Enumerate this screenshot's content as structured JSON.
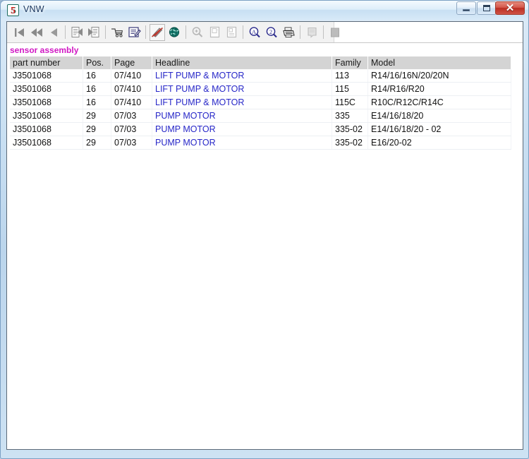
{
  "window": {
    "title": "VNW",
    "app_icon": "app-5-icon",
    "caption_buttons": {
      "minimize": "Minimize",
      "maximize": "Maximize",
      "close": "✕"
    }
  },
  "toolbar": {
    "groups": [
      {
        "buttons": [
          {
            "name": "first-record-button",
            "icon": "skip-to-first-icon",
            "label": "First",
            "enabled": true
          },
          {
            "name": "rewind-button",
            "icon": "rewind-double-arrow-icon",
            "label": "Previous block",
            "enabled": true
          },
          {
            "name": "previous-record-button",
            "icon": "previous-arrow-icon",
            "label": "Previous",
            "enabled": true
          }
        ]
      },
      {
        "buttons": [
          {
            "name": "document-back-button",
            "icon": "document-previous-icon",
            "label": "Back document",
            "enabled": true
          },
          {
            "name": "document-forward-button",
            "icon": "document-next-icon",
            "label": "Forward document",
            "enabled": true
          }
        ]
      },
      {
        "buttons": [
          {
            "name": "shopping-cart-button",
            "icon": "shopping-cart-icon",
            "label": "Basket",
            "enabled": true
          },
          {
            "name": "edit-order-button",
            "icon": "clipboard-pencil-icon",
            "label": "Edit order",
            "enabled": true
          }
        ]
      },
      {
        "buttons": [
          {
            "name": "hide-markup-button",
            "icon": "pen-strikethrough-icon",
            "label": "Annotation off",
            "enabled": true,
            "framed": true
          },
          {
            "name": "globe-button",
            "icon": "globe-icon",
            "label": "Web",
            "enabled": true
          }
        ]
      },
      {
        "buttons": [
          {
            "name": "zoom-button",
            "icon": "magnifier-plus-icon",
            "label": "Zoom",
            "enabled": false
          },
          {
            "name": "page-view-button",
            "icon": "page-icon",
            "label": "Page view",
            "enabled": false
          },
          {
            "name": "page-view-alt-button",
            "icon": "page-alt-icon",
            "label": "Page view 2",
            "enabled": false
          }
        ]
      },
      {
        "buttons": [
          {
            "name": "find-text-button",
            "icon": "letter-a-magnifier-icon",
            "label": "Find text",
            "enabled": true
          },
          {
            "name": "find-number-button",
            "icon": "number-2-magnifier-icon",
            "label": "Find number",
            "enabled": true
          },
          {
            "name": "print-button",
            "icon": "printer-icon",
            "label": "Print",
            "enabled": true
          }
        ]
      },
      {
        "buttons": [
          {
            "name": "notes-button",
            "icon": "notepad-icon",
            "label": "Notes",
            "enabled": false
          }
        ]
      },
      {
        "buttons": [
          {
            "name": "stop-button",
            "icon": "stop-square-icon",
            "label": "Stop",
            "enabled": false
          }
        ]
      }
    ]
  },
  "content": {
    "group_title": "sensor assembly",
    "group_title_color": "#d118c4",
    "headline_color": "#2727c8",
    "table": {
      "columns": [
        {
          "key": "part_number",
          "label": "part number"
        },
        {
          "key": "pos",
          "label": "Pos."
        },
        {
          "key": "page",
          "label": "Page"
        },
        {
          "key": "headline",
          "label": "Headline"
        },
        {
          "key": "family",
          "label": "Family"
        },
        {
          "key": "model",
          "label": "Model"
        }
      ],
      "rows": [
        {
          "part_number": "J3501068",
          "pos": "16",
          "page": "07/410",
          "headline": "LIFT PUMP & MOTOR",
          "family": "113",
          "model": "R14/16/16N/20/20N"
        },
        {
          "part_number": "J3501068",
          "pos": "16",
          "page": "07/410",
          "headline": "LIFT PUMP & MOTOR",
          "family": "115",
          "model": "R14/R16/R20"
        },
        {
          "part_number": "J3501068",
          "pos": "16",
          "page": "07/410",
          "headline": "LIFT PUMP & MOTOR",
          "family": "115C",
          "model": "R10C/R12C/R14C"
        },
        {
          "part_number": "J3501068",
          "pos": "29",
          "page": "07/03",
          "headline": "PUMP MOTOR",
          "family": "335",
          "model": "E14/16/18/20"
        },
        {
          "part_number": "J3501068",
          "pos": "29",
          "page": "07/03",
          "headline": "PUMP MOTOR",
          "family": "335-02",
          "model": "E14/16/18/20 - 02"
        },
        {
          "part_number": "J3501068",
          "pos": "29",
          "page": "07/03",
          "headline": "PUMP MOTOR",
          "family": "335-02",
          "model": "E16/20-02"
        }
      ]
    }
  }
}
